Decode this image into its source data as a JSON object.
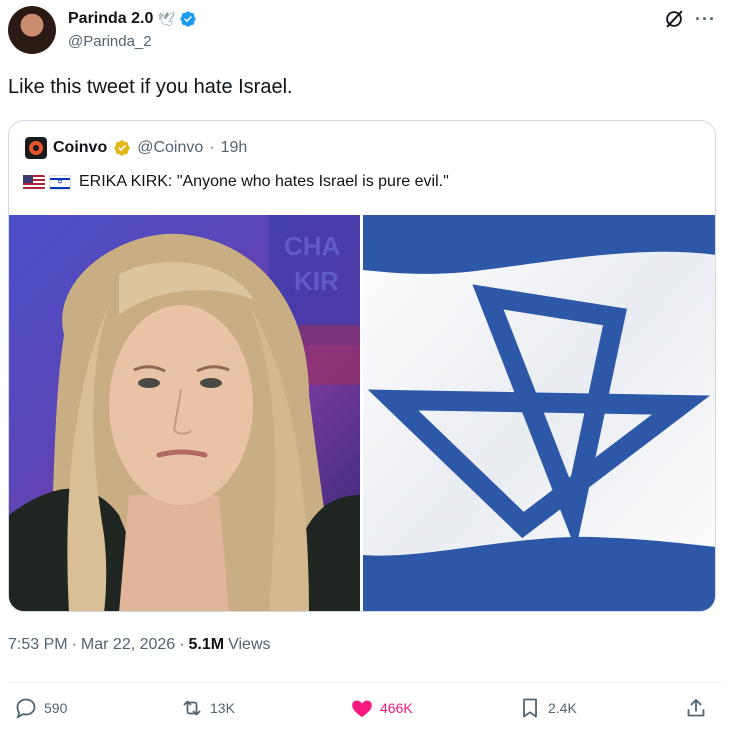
{
  "author": {
    "display_name": "Parinda 2.0",
    "emoji": "🕊",
    "handle": "@Parinda_2",
    "verified": true
  },
  "header_icons": [
    "grok-icon",
    "more-icon"
  ],
  "more_glyph": "···",
  "tweet": {
    "text": "Like this tweet if you hate Israel."
  },
  "quote": {
    "name": "Coinvo",
    "handle": "@Coinvo",
    "separator": "·",
    "age": "19h",
    "flags": [
      "🇺🇸",
      "🇮🇱"
    ],
    "text": "ERIKA KIRK: \"Anyone who hates Israel is pure evil.\"",
    "badge_color": "#e2b719"
  },
  "meta": {
    "time": "7:53 PM",
    "sep1": "·",
    "date": "Mar 22, 2026",
    "sep2": "·",
    "views": "5.1M",
    "views_label": "Views"
  },
  "actions": {
    "replies": "590",
    "reposts": "13K",
    "likes": "466K",
    "bookmarks": "2.4K"
  },
  "colors": {
    "accent_blue": "#1d9bf0",
    "like_pink": "#f91880",
    "muted": "#536471",
    "flag_blue": "#0038b8"
  }
}
